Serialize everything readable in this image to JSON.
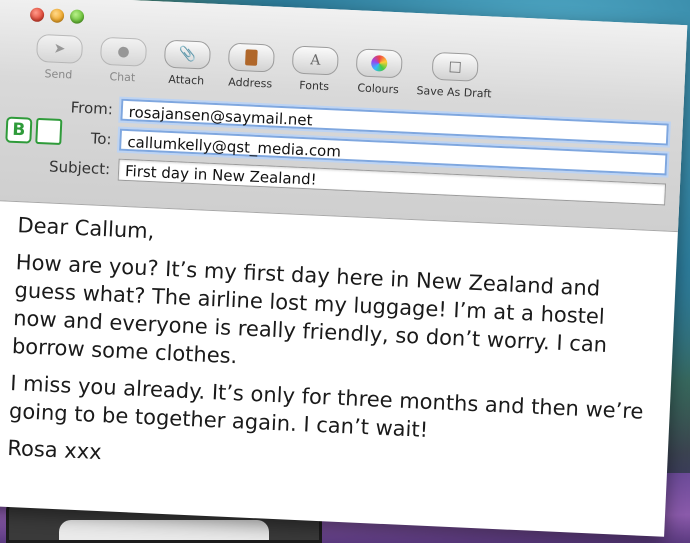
{
  "toolbar": {
    "items": [
      {
        "label": "Send",
        "icon": "send-icon",
        "enabled": false
      },
      {
        "label": "Chat",
        "icon": "chat-icon",
        "enabled": false
      },
      {
        "label": "Attach",
        "icon": "paperclip-icon",
        "enabled": true
      },
      {
        "label": "Address",
        "icon": "address-book-icon",
        "enabled": true
      },
      {
        "label": "Fonts",
        "icon": "fonts-icon",
        "enabled": true
      },
      {
        "label": "Colours",
        "icon": "colour-wheel-icon",
        "enabled": true
      },
      {
        "label": "Save As Draft",
        "icon": "save-draft-icon",
        "enabled": true
      }
    ]
  },
  "fields": {
    "from_label": "From:",
    "from_value": "rosajansen@saymail.net",
    "to_label": "To:",
    "to_value": "callumkelly@qst_media.com",
    "subject_label": "Subject:",
    "subject_value": "First day in New Zealand!"
  },
  "badge": {
    "letter": "B"
  },
  "message": {
    "greeting": "Dear Callum,",
    "paragraph1": "How are you? It’s my first day here in New Zealand and guess what? The airline lost my luggage! I’m at a hostel now and everyone is really friendly, so don’t worry. I can borrow some clothes.",
    "paragraph2": "I miss you already. It’s only for three months and then we’re going to be together again. I can’t wait!",
    "signoff": "Rosa xxx"
  },
  "colors": {
    "badge_green": "#2f9b3a",
    "focus_blue": "#7fa7df"
  }
}
